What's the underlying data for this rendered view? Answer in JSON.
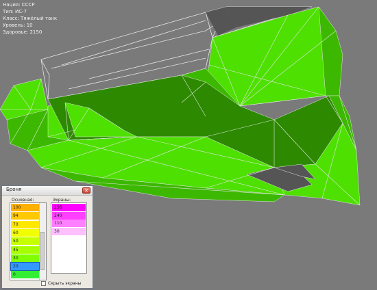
{
  "tank_info": {
    "nation": "Нация: СССР",
    "type": "Тип: ИС-7",
    "class": "Класс: Тяжёлый танк",
    "level": "Уровень: 10",
    "health": "Здоровье: 2150"
  },
  "colors": {
    "background": "#7a7a7a",
    "hull_green_bright": "#4ee000",
    "hull_green_mid": "#3db800",
    "hull_green_dark": "#2d8a00",
    "uncovered": "#555555",
    "mesh_line": "#e6e6e6"
  },
  "armor_window": {
    "title": "Броня",
    "close_icon": "close-icon",
    "base_label": "Основная:",
    "screens_label": "Экраны:",
    "base_values": [
      {
        "value": "100",
        "color": "#ffb000"
      },
      {
        "value": "94",
        "color": "#ffc800"
      },
      {
        "value": "70",
        "color": "#ffe800"
      },
      {
        "value": "60",
        "color": "#f2ff00"
      },
      {
        "value": "50",
        "color": "#c6ff00"
      },
      {
        "value": "45",
        "color": "#a8ff00"
      },
      {
        "value": "30",
        "color": "#80ff00"
      },
      {
        "value": "20",
        "color": "#3399ff"
      },
      {
        "value": "0",
        "color": "#33ee33"
      }
    ],
    "selected_base": "20",
    "screen_values": [
      {
        "value": "256",
        "color": "#ff00ff"
      },
      {
        "value": "240",
        "color": "#ff40ff"
      },
      {
        "value": "110",
        "color": "#ff80ff"
      },
      {
        "value": "30",
        "color": "#ffc0ff"
      }
    ],
    "hide_screens_label": "Скрыть экраны",
    "hide_screens_checked": false
  }
}
